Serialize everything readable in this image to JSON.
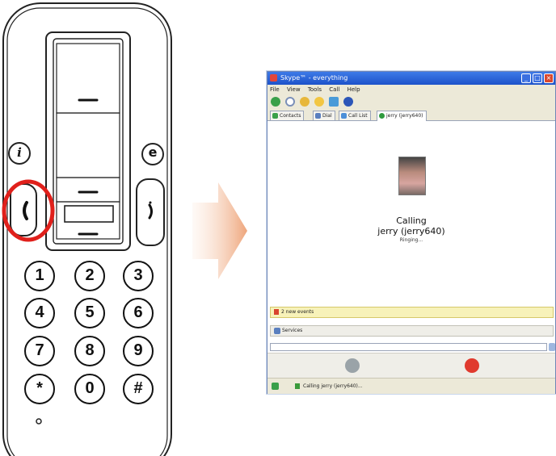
{
  "phone": {
    "keys": [
      "1",
      "2",
      "3",
      "4",
      "5",
      "6",
      "7",
      "8",
      "9",
      "*",
      "0",
      "#"
    ],
    "info_key": "i",
    "email_key": "e"
  },
  "app": {
    "title": "Skype™ - everything",
    "menu": [
      "File",
      "View",
      "Tools",
      "Call",
      "Help"
    ],
    "tabs": [
      {
        "label": "Contacts",
        "color": "#3aa04a"
      },
      {
        "label": "Dial",
        "color": "#5a7fbf"
      },
      {
        "label": "Call List",
        "color": "#4c8fd8"
      },
      {
        "label": "jerry (jerry640)",
        "color": "#2e9a3e"
      }
    ],
    "call": {
      "calling_label": "Calling",
      "contact": "jerry (jerry640)",
      "status": "Ringing..."
    },
    "events": "2 new events",
    "services": "Services",
    "statusbar": "Calling jerry (jerry640)..."
  },
  "colors": {
    "highlight": "#e0201b",
    "arrow": "#eea57b",
    "call_green": "#3aa04a",
    "hangup_red": "#e03a2e"
  }
}
